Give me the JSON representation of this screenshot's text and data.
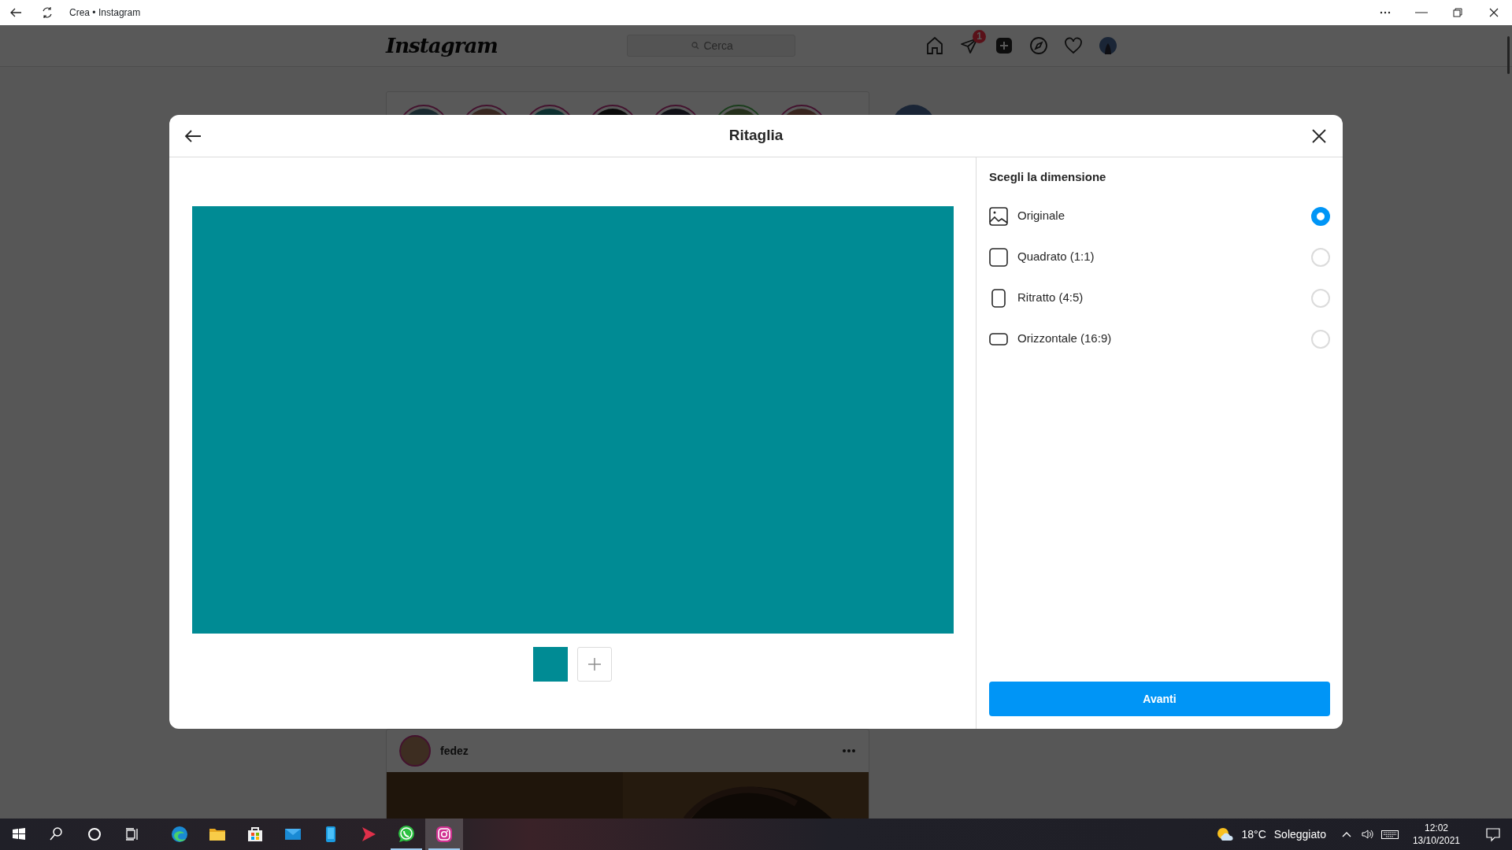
{
  "browser": {
    "title": "Crea • Instagram"
  },
  "nav": {
    "logo": "Instagram",
    "search": {
      "placeholder": "Cerca"
    },
    "messages_badge": "1"
  },
  "dialog": {
    "title": "Ritaglia",
    "section_title": "Scegli la dimensione",
    "options": [
      {
        "kind": "original",
        "label": "Originale",
        "selected": true
      },
      {
        "kind": "square",
        "label": "Quadrato (1:1)",
        "selected": false
      },
      {
        "kind": "portrait",
        "label": "Ritratto (4:5)",
        "selected": false
      },
      {
        "kind": "landscape",
        "label": "Orizzontale (16:9)",
        "selected": false
      }
    ],
    "next_button": "Avanti"
  },
  "post": {
    "username": "fedez"
  },
  "taskbar": {
    "apps": [
      {
        "kind": "edge",
        "running": false,
        "selected": false
      },
      {
        "kind": "explorer",
        "running": false,
        "selected": false
      },
      {
        "kind": "store",
        "running": false,
        "selected": false
      },
      {
        "kind": "mail",
        "running": false,
        "selected": false
      },
      {
        "kind": "phone",
        "running": false,
        "selected": false
      },
      {
        "kind": "play",
        "running": false,
        "selected": false
      },
      {
        "kind": "whatsapp",
        "running": true,
        "selected": false
      },
      {
        "kind": "instagram",
        "running": true,
        "selected": true
      }
    ],
    "temperature": "18°C",
    "weather": "Soleggiato",
    "time": "12:02",
    "date": "13/10/2021"
  }
}
